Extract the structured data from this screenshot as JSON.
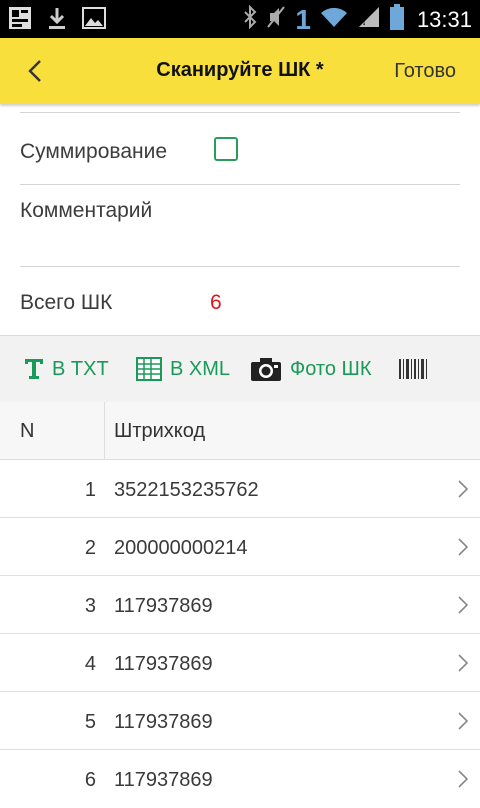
{
  "status_bar": {
    "time": "13:31",
    "sim_indicator": "1",
    "icons": [
      "notification-icon",
      "download-icon",
      "gallery-icon",
      "bluetooth-icon",
      "mute-icon",
      "wifi-icon",
      "signal-icon",
      "battery-icon"
    ]
  },
  "app_bar": {
    "title": "Сканируйте ШК *",
    "done_label": "Готово",
    "background": "#f8df3c"
  },
  "form": {
    "summation_label": "Суммирование",
    "summation_checked": false,
    "comment_label": "Комментарий",
    "comment_value": "",
    "total_label": "Всего ШК",
    "total_value": "6"
  },
  "toolbar": {
    "txt_label": "В TXT",
    "xml_label": "В XML",
    "photo_label": "Фото ШК",
    "accent_color": "#1a9a58"
  },
  "table": {
    "columns": [
      "N",
      "Штрихкод"
    ],
    "rows": [
      {
        "n": "1",
        "code": "3522153235762"
      },
      {
        "n": "2",
        "code": "200000000214"
      },
      {
        "n": "3",
        "code": "117937869"
      },
      {
        "n": "4",
        "code": "117937869"
      },
      {
        "n": "5",
        "code": "117937869"
      },
      {
        "n": "6",
        "code": "117937869"
      }
    ]
  }
}
